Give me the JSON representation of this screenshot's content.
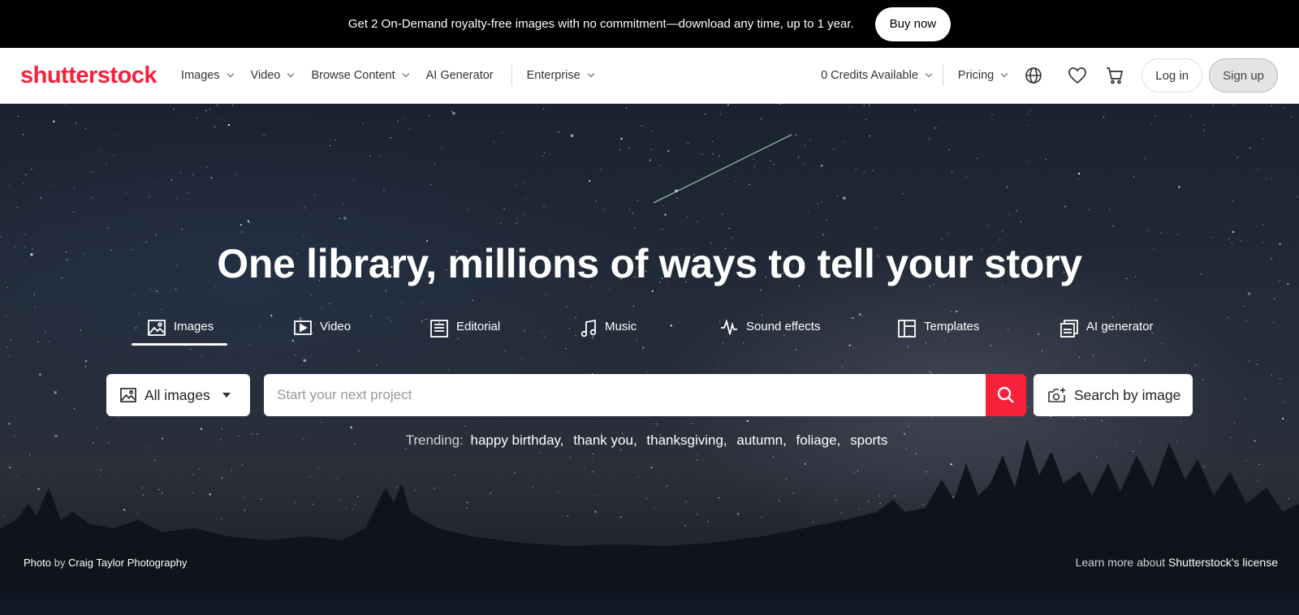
{
  "promo": {
    "text": "Get 2 On-Demand royalty-free images with no commitment—download any time, up to 1 year.",
    "button": "Buy now"
  },
  "nav": {
    "logo": "shutterstock",
    "items": [
      "Images",
      "Video",
      "Browse Content",
      "AI Generator",
      "Enterprise"
    ],
    "credits": "0 Credits Available",
    "pricing": "Pricing",
    "login": "Log in",
    "signup": "Sign up",
    "icons": [
      "globe-icon",
      "heart-icon",
      "cart-icon"
    ]
  },
  "hero": {
    "title": "One library, millions of ways to tell your story",
    "tabs": [
      {
        "label": "Images",
        "icon": "image-icon",
        "active": true
      },
      {
        "label": "Video",
        "icon": "video-icon"
      },
      {
        "label": "Editorial",
        "icon": "editorial-icon"
      },
      {
        "label": "Music",
        "icon": "music-icon"
      },
      {
        "label": "Sound effects",
        "icon": "waveform-icon"
      },
      {
        "label": "Templates",
        "icon": "templates-icon"
      },
      {
        "label": "AI generator",
        "icon": "ai-generator-icon"
      }
    ],
    "type_select": "All images",
    "search_placeholder": "Start your next project",
    "search_by_image": "Search by image",
    "trending_label": "Trending:",
    "trending": [
      "happy birthday,",
      "thank you,",
      "thanksgiving,",
      "autumn,",
      "foliage,",
      "sports"
    ],
    "credit_prefix": "Photo",
    "credit_by": "by",
    "credit_name": "Craig Taylor Photography",
    "license_prefix": "Learn more about",
    "license_link": "Shutterstock's license"
  },
  "colors": {
    "brand": "#f7213b",
    "promo_bg": "#000000"
  }
}
